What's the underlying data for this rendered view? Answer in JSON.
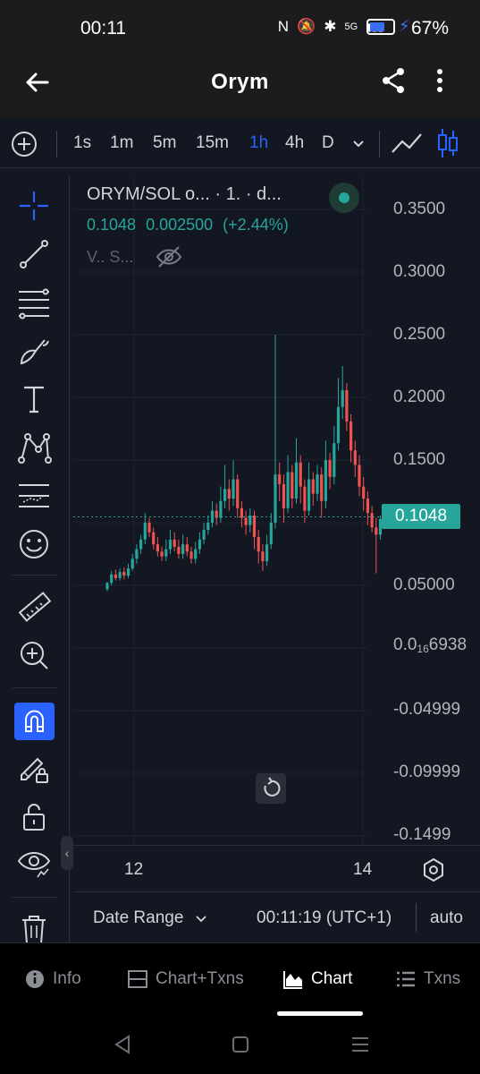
{
  "status_bar": {
    "time": "00:11",
    "icons": [
      "N",
      "🔕",
      "✱",
      "5G",
      "▮▮▮"
    ],
    "battery_pct": "67%",
    "battery_level": 0.67
  },
  "header": {
    "title": "Orym"
  },
  "toolbar": {
    "intervals": [
      "1s",
      "1m",
      "5m",
      "15m",
      "1h",
      "4h",
      "D"
    ],
    "active_interval": "1h"
  },
  "legend": {
    "title": "ORYM/SOL o...   · 1. · d...",
    "price": "0.1048",
    "change": "0.002500",
    "change_pct": "(+2.44%)",
    "volume_label": "V.. S..."
  },
  "price_axis": {
    "labels": [
      "0.3500",
      "0.3000",
      "0.2500",
      "0.2000",
      "0.1500",
      "0.05000",
      "-0.04999",
      "-0.09999",
      "-0.1499"
    ],
    "zero_label_main": "0.0",
    "zero_label_sub": "16",
    "zero_label_tail": "6938",
    "current_price": "0.1048"
  },
  "time_axis": {
    "labels": [
      "12",
      "14"
    ]
  },
  "range_bar": {
    "date_range": "Date Range",
    "clock": "00:11:19 (UTC+1)",
    "scale_mode": "auto"
  },
  "tabs": [
    {
      "label": "Info",
      "icon": "info-icon"
    },
    {
      "label": "Chart+Txns",
      "icon": "split-view-icon"
    },
    {
      "label": "Chart",
      "icon": "chart-icon"
    },
    {
      "label": "Txns",
      "icon": "list-icon"
    }
  ],
  "active_tab": "Chart",
  "colors": {
    "up": "#26a69a",
    "down": "#ef5350",
    "accent": "#2962ff",
    "bg": "#131722"
  },
  "chart_data": {
    "type": "candlestick",
    "ylim": [
      -0.16,
      0.36
    ],
    "current_price": 0.1048,
    "candles": [
      [
        0.045,
        0.05,
        0.043,
        0.051
      ],
      [
        0.05,
        0.057,
        0.048,
        0.06
      ],
      [
        0.057,
        0.054,
        0.052,
        0.061
      ],
      [
        0.054,
        0.059,
        0.052,
        0.062
      ],
      [
        0.059,
        0.056,
        0.053,
        0.063
      ],
      [
        0.056,
        0.062,
        0.054,
        0.066
      ],
      [
        0.062,
        0.07,
        0.06,
        0.074
      ],
      [
        0.07,
        0.078,
        0.066,
        0.082
      ],
      [
        0.078,
        0.086,
        0.074,
        0.09
      ],
      [
        0.086,
        0.1,
        0.082,
        0.108
      ],
      [
        0.1,
        0.092,
        0.088,
        0.104
      ],
      [
        0.092,
        0.082,
        0.078,
        0.096
      ],
      [
        0.082,
        0.076,
        0.072,
        0.088
      ],
      [
        0.076,
        0.072,
        0.068,
        0.08
      ],
      [
        0.072,
        0.078,
        0.068,
        0.086
      ],
      [
        0.078,
        0.086,
        0.074,
        0.094
      ],
      [
        0.086,
        0.08,
        0.076,
        0.092
      ],
      [
        0.08,
        0.074,
        0.07,
        0.086
      ],
      [
        0.074,
        0.082,
        0.07,
        0.09
      ],
      [
        0.082,
        0.076,
        0.072,
        0.088
      ],
      [
        0.076,
        0.07,
        0.066,
        0.08
      ],
      [
        0.07,
        0.078,
        0.066,
        0.084
      ],
      [
        0.078,
        0.086,
        0.074,
        0.092
      ],
      [
        0.086,
        0.094,
        0.082,
        0.1
      ],
      [
        0.094,
        0.1,
        0.09,
        0.106
      ],
      [
        0.1,
        0.11,
        0.096,
        0.118
      ],
      [
        0.11,
        0.104,
        0.098,
        0.116
      ],
      [
        0.104,
        0.118,
        0.1,
        0.13
      ],
      [
        0.118,
        0.128,
        0.112,
        0.148
      ],
      [
        0.128,
        0.12,
        0.11,
        0.136
      ],
      [
        0.12,
        0.136,
        0.114,
        0.152
      ],
      [
        0.136,
        0.112,
        0.104,
        0.14
      ],
      [
        0.112,
        0.104,
        0.096,
        0.118
      ],
      [
        0.104,
        0.098,
        0.09,
        0.11
      ],
      [
        0.098,
        0.106,
        0.092,
        0.112
      ],
      [
        0.106,
        0.088,
        0.078,
        0.11
      ],
      [
        0.088,
        0.076,
        0.066,
        0.094
      ],
      [
        0.076,
        0.068,
        0.06,
        0.082
      ],
      [
        0.068,
        0.082,
        0.064,
        0.09
      ],
      [
        0.082,
        0.1,
        0.078,
        0.108
      ],
      [
        0.1,
        0.14,
        0.095,
        0.256
      ],
      [
        0.14,
        0.132,
        0.118,
        0.15
      ],
      [
        0.132,
        0.112,
        0.1,
        0.14
      ],
      [
        0.112,
        0.142,
        0.108,
        0.156
      ],
      [
        0.142,
        0.12,
        0.112,
        0.148
      ],
      [
        0.12,
        0.15,
        0.116,
        0.17
      ],
      [
        0.15,
        0.13,
        0.116,
        0.156
      ],
      [
        0.13,
        0.11,
        0.1,
        0.136
      ],
      [
        0.11,
        0.136,
        0.106,
        0.15
      ],
      [
        0.136,
        0.124,
        0.114,
        0.142
      ],
      [
        0.124,
        0.14,
        0.118,
        0.148
      ],
      [
        0.14,
        0.118,
        0.104,
        0.146
      ],
      [
        0.118,
        0.152,
        0.112,
        0.168
      ],
      [
        0.152,
        0.138,
        0.128,
        0.158
      ],
      [
        0.138,
        0.166,
        0.132,
        0.18
      ],
      [
        0.166,
        0.196,
        0.16,
        0.22
      ],
      [
        0.196,
        0.21,
        0.186,
        0.23
      ],
      [
        0.21,
        0.184,
        0.176,
        0.216
      ],
      [
        0.184,
        0.16,
        0.15,
        0.19
      ],
      [
        0.16,
        0.148,
        0.138,
        0.168
      ],
      [
        0.148,
        0.13,
        0.122,
        0.156
      ],
      [
        0.13,
        0.12,
        0.11,
        0.138
      ],
      [
        0.12,
        0.108,
        0.098,
        0.126
      ],
      [
        0.108,
        0.096,
        0.092,
        0.114
      ],
      [
        0.096,
        0.09,
        0.058,
        0.104
      ],
      [
        0.09,
        0.103,
        0.086,
        0.106
      ],
      [
        0.103,
        0.1048,
        0.1,
        0.11
      ]
    ]
  }
}
